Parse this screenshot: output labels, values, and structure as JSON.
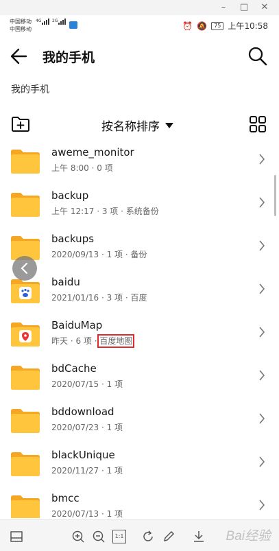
{
  "status_bar": {
    "carrier1": "中国移动",
    "carrier1_net": "4G",
    "carrier2": "中国移动",
    "carrier2_net": "2G",
    "battery": "75",
    "time": "上午10:58"
  },
  "header": {
    "title": "我的手机"
  },
  "breadcrumb": "我的手机",
  "toolbar": {
    "sort_label": "按名称排序"
  },
  "files": [
    {
      "name": "aweme_monitor",
      "meta": "上午 8:00 · 0 项"
    },
    {
      "name": "backup",
      "meta": "上午 12:17 · 3 项 · 系统备份"
    },
    {
      "name": "backups",
      "meta": "2020/09/13 · 1 项 · 备份"
    },
    {
      "name": "baidu",
      "meta": "2021/01/16 · 3 项 · 百度"
    },
    {
      "name": "BaiduMap",
      "meta_prefix": "昨天 · 6 项 · ",
      "meta_highlight": "百度地图"
    },
    {
      "name": "bdCache",
      "meta": "2020/07/15 · 1 项"
    },
    {
      "name": "bddownload",
      "meta": "2020/07/23 · 1 项"
    },
    {
      "name": "blackUnique",
      "meta": "2020/11/27 · 1 项"
    },
    {
      "name": "bmcc",
      "meta": "2020/07/13 · 1 项"
    }
  ],
  "bottom_bar": {
    "fit_label": "1:1",
    "watermark": "Bai经验"
  },
  "colors": {
    "folder": "#FFC53D",
    "folder_tab": "#F5A623",
    "highlight": "#E02A2A"
  }
}
